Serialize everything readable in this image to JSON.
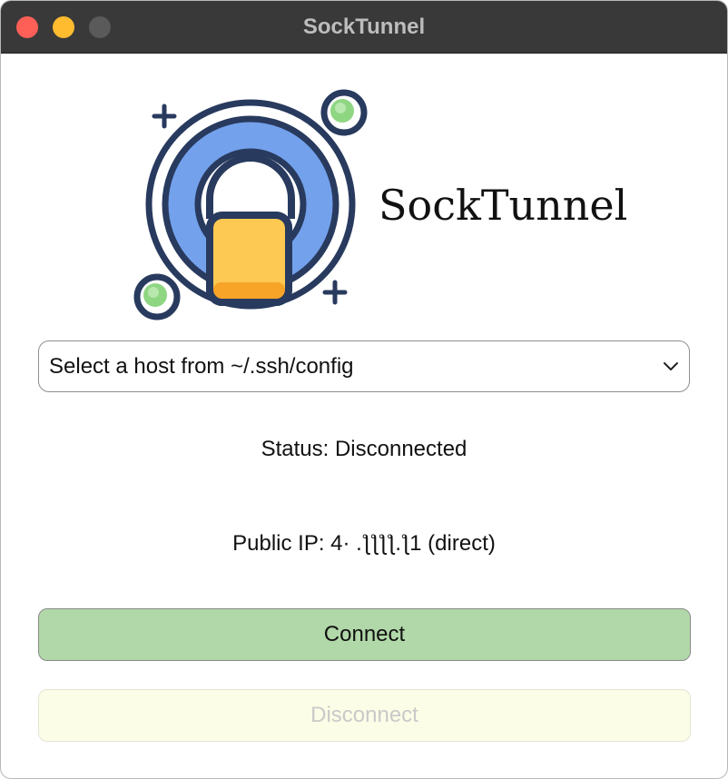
{
  "window": {
    "title": "SockTunnel"
  },
  "logo": {
    "brand_text": "SockTunnel",
    "colors": {
      "outline": "#283a5e",
      "ring_blue": "#73a1ec",
      "lock_yellow": "#fdc952",
      "lock_orange": "#f8a428",
      "dot_green": "#8fd683"
    }
  },
  "host_select": {
    "selected_value": "Select a host from ~/.ssh/config",
    "icon": "chevron-down-icon"
  },
  "status": {
    "text": "Status: Disconnected"
  },
  "public_ip": {
    "text": "Public IP: 4· .ƪƪƪƪ.ƪ1 (direct)"
  },
  "buttons": {
    "connect_label": "Connect",
    "disconnect_label": "Disconnect"
  },
  "colors": {
    "connect_bg": "#b1d8a8",
    "disconnect_bg": "#fbfde6",
    "titlebar_bg": "#393939"
  }
}
